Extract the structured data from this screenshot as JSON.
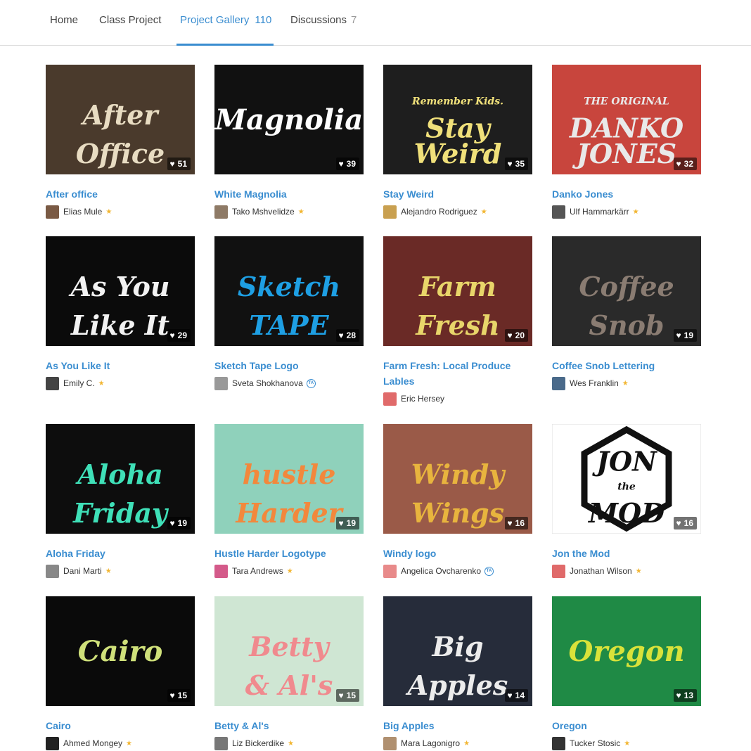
{
  "tabs": [
    {
      "label": "Home",
      "count": ""
    },
    {
      "label": "Class Project",
      "count": ""
    },
    {
      "label": "Project Gallery",
      "count": "110"
    },
    {
      "label": "Discussions",
      "count": "7"
    }
  ],
  "projects": [
    {
      "title": "After office",
      "author": "Elias Mule",
      "likes": "51",
      "badge": "star",
      "thumb_text": [
        "After",
        "Office"
      ],
      "colors": {
        "bg": "#4a3a2c",
        "fg": "#e8dcc2"
      }
    },
    {
      "title": "White Magnolia",
      "author": "Tako Mshvelidze",
      "likes": "39",
      "badge": "star",
      "thumb_text": [
        "Magnolia"
      ],
      "colors": {
        "bg": "#111111",
        "fg": "#ffffff"
      }
    },
    {
      "title": "Stay Weird",
      "author": "Alejandro Rodriguez",
      "likes": "35",
      "badge": "star",
      "thumb_text": [
        "Remember Kids.",
        "Stay",
        "Weird"
      ],
      "colors": {
        "bg": "#1e1e1e",
        "fg": "#f0e07a"
      }
    },
    {
      "title": "Danko Jones",
      "author": "Ulf Hammarkärr",
      "likes": "32",
      "badge": "star",
      "thumb_text": [
        "THE ORIGINAL",
        "DANKO",
        "JONES"
      ],
      "colors": {
        "bg": "#c8453d",
        "fg": "#e9e9e9"
      }
    },
    {
      "title": "As You Like It",
      "author": "Emily C.",
      "likes": "29",
      "badge": "star",
      "thumb_text": [
        "As You",
        "Like It"
      ],
      "colors": {
        "bg": "#0b0b0b",
        "fg": "#f2f2f2"
      }
    },
    {
      "title": "Sketch Tape Logo",
      "author": "Sveta Shokhanova",
      "likes": "28",
      "badge": "ta",
      "thumb_text": [
        "Sketch",
        "TAPE"
      ],
      "colors": {
        "bg": "#111111",
        "fg": "#1e9fe3"
      }
    },
    {
      "title": "Farm Fresh: Local Produce Lables",
      "author": "Eric Hersey",
      "likes": "20",
      "badge": "none",
      "thumb_text": [
        "Farm",
        "Fresh"
      ],
      "colors": {
        "bg": "#6a2a26",
        "fg": "#e8d56a"
      }
    },
    {
      "title": "Coffee Snob Lettering",
      "author": "Wes Franklin",
      "likes": "19",
      "badge": "star",
      "thumb_text": [
        "Coffee",
        "Snob"
      ],
      "colors": {
        "bg": "#2a2a2a",
        "fg": "#8a7c72"
      }
    },
    {
      "title": "Aloha Friday",
      "author": "Dani Marti",
      "likes": "19",
      "badge": "star",
      "thumb_text": [
        "Aloha",
        "Friday"
      ],
      "colors": {
        "bg": "#0d0d0d",
        "fg": "#3fe0b8"
      }
    },
    {
      "title": "Hustle Harder Logotype",
      "author": "Tara Andrews",
      "likes": "19",
      "badge": "star",
      "thumb_text": [
        "hustle",
        "Harder"
      ],
      "colors": {
        "bg": "#8fd1bb",
        "fg": "#f2883c"
      }
    },
    {
      "title": "Windy logo",
      "author": "Angelica Ovcharenko",
      "likes": "16",
      "badge": "ta",
      "thumb_text": [
        "Windy",
        "Wings"
      ],
      "colors": {
        "bg": "#9a5a48",
        "fg": "#e8b43e"
      }
    },
    {
      "title": "Jon the Mod",
      "author": "Jonathan Wilson",
      "likes": "16",
      "badge": "star",
      "thumb_text": [
        "JON",
        "the",
        "MOD"
      ],
      "colors": {
        "bg": "#ffffff",
        "fg": "#111111"
      }
    },
    {
      "title": "Cairo",
      "author": "Ahmed Mongey",
      "likes": "15",
      "badge": "star",
      "thumb_text": [
        "Cairo"
      ],
      "colors": {
        "bg": "#0a0a0a",
        "fg": "#cfe07a"
      }
    },
    {
      "title": "Betty & Al's",
      "author": "Liz Bickerdike",
      "likes": "15",
      "badge": "star",
      "thumb_text": [
        "Betty",
        "& Al's"
      ],
      "colors": {
        "bg": "#cfe6d3",
        "fg": "#f08a8e"
      }
    },
    {
      "title": "Big Apples",
      "author": "Mara Lagonigro",
      "likes": "14",
      "badge": "star",
      "thumb_text": [
        "Big",
        "Apples"
      ],
      "colors": {
        "bg": "#262c3a",
        "fg": "#ececec"
      }
    },
    {
      "title": "Oregon",
      "author": "Tucker Stosic",
      "likes": "13",
      "badge": "star",
      "thumb_text": [
        "Oregon"
      ],
      "colors": {
        "bg": "#1f8a45",
        "fg": "#d9e23a"
      }
    }
  ]
}
